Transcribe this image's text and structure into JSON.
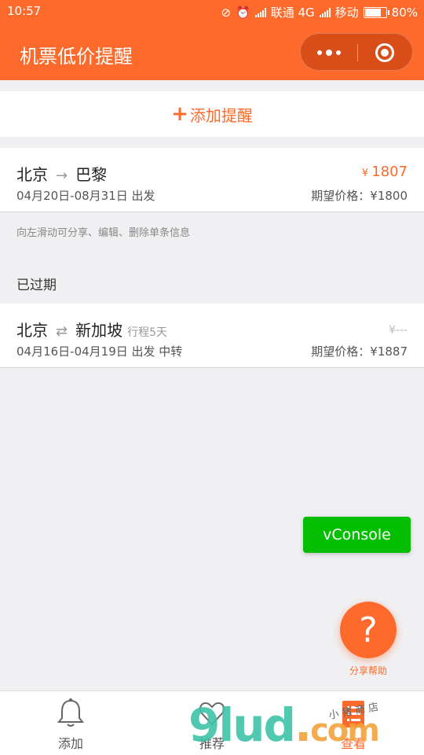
{
  "status": {
    "time": "10:57",
    "carrier1": "联通 4G",
    "carrier2": "移动",
    "battery_text": "80%",
    "battery_level": 0.8
  },
  "navbar": {
    "title": "机票低价提醒"
  },
  "add": {
    "label": "添加提醒"
  },
  "active": [
    {
      "from": "北京",
      "arrow": "→",
      "to": "巴黎",
      "tag": "",
      "dates": "04月20日-08月31日 出发",
      "price_symbol": "¥",
      "price": "1807",
      "expect": "期望价格：¥1800"
    }
  ],
  "hint": "向左滑动可分享、编辑、删除单条信息",
  "expired_title": "已过期",
  "expired": [
    {
      "from": "北京",
      "arrow": "⇄",
      "to": "新加坡",
      "tag": "行程5天",
      "dates": "04月16日-04月19日 出发 中转",
      "price": "¥---",
      "expect": "期望价格：¥1887"
    }
  ],
  "vconsole": "vConsole",
  "help": {
    "icon": "?",
    "label": "分享帮助"
  },
  "tabs": [
    {
      "label": "添加",
      "icon": "bell-icon"
    },
    {
      "label": "推荐",
      "icon": "heart-icon"
    },
    {
      "label": "查看",
      "icon": "list-icon"
    }
  ],
  "watermark": {
    "main": "9lud",
    "dot": ".",
    "com": "com",
    "small": "小猪商店"
  },
  "colors": {
    "accent": "#fd6a2b",
    "vconsole": "#04be02",
    "background": "#f0f0f2"
  }
}
